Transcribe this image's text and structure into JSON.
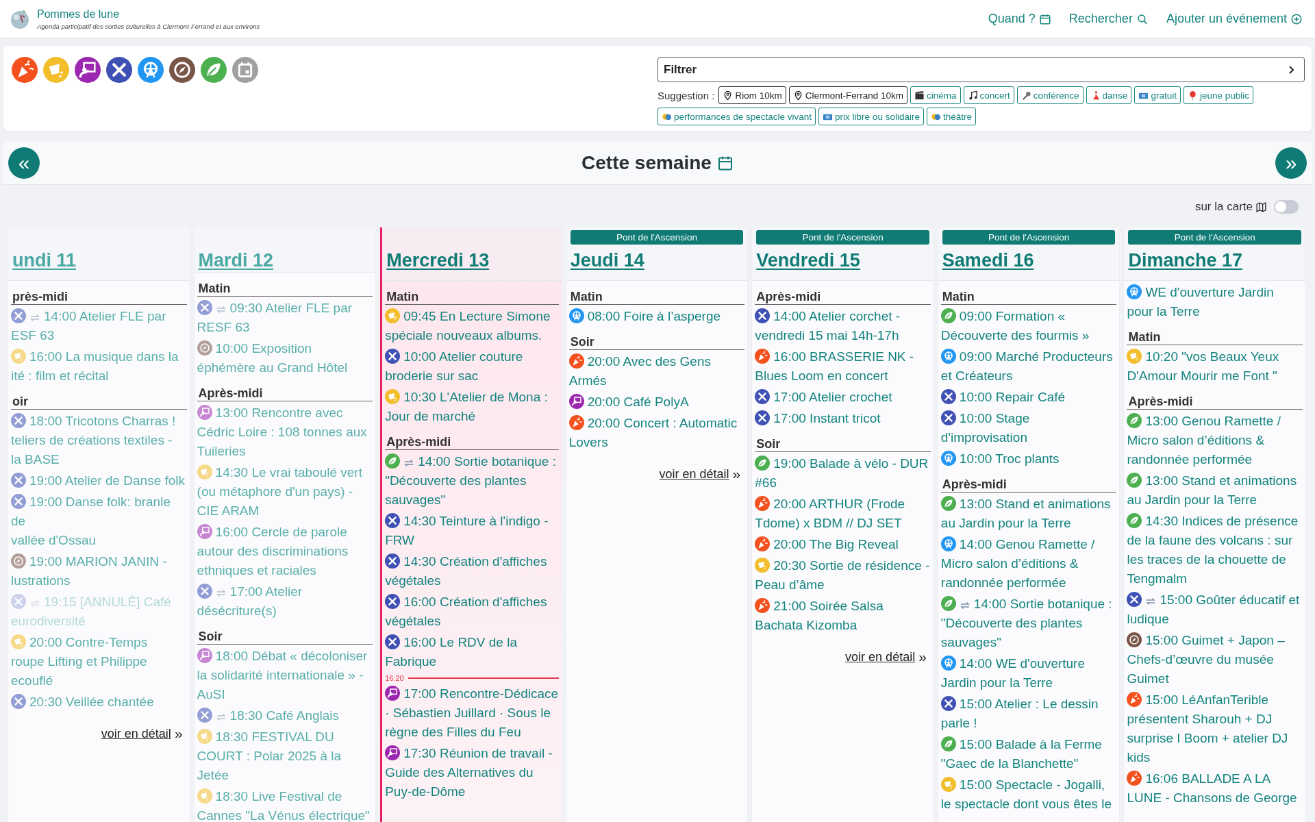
{
  "site": {
    "title": "Pommes de lune",
    "tagline": "Agenda participatif des sorties culturelles à Clermont-Ferrand et aux environs"
  },
  "nav": [
    {
      "kind": "calendar",
      "label": "Quand ?"
    },
    {
      "kind": "search",
      "label": "Rechercher"
    },
    {
      "kind": "add",
      "label": "Ajouter un événement"
    }
  ],
  "categories": [
    {
      "kind": "fete"
    },
    {
      "kind": "spectacle"
    },
    {
      "kind": "rencontre"
    },
    {
      "kind": "atelier"
    },
    {
      "kind": "collectif"
    },
    {
      "kind": "visite"
    },
    {
      "kind": "nature"
    },
    {
      "kind": "agenda"
    }
  ],
  "filter": {
    "label": "Filtrer"
  },
  "suggestions": {
    "label": "Suggestion :",
    "chips": [
      {
        "kind": "place",
        "label": "Riom 10km"
      },
      {
        "kind": "place",
        "label": "Clermont-Ferrand 10km"
      },
      {
        "kind": "cinema",
        "label": "cinéma"
      },
      {
        "kind": "concert",
        "label": "concert"
      },
      {
        "kind": "conference",
        "label": "conférence"
      },
      {
        "kind": "danse",
        "label": "danse"
      },
      {
        "kind": "gratuit",
        "label": "gratuit"
      },
      {
        "kind": "jeune-public",
        "label": "jeune public"
      },
      {
        "kind": "spectacle",
        "label": "performances de spectacle vivant"
      },
      {
        "kind": "gratuit",
        "label": "prix libre ou solidaire"
      },
      {
        "kind": "spectacle",
        "label": "théâtre"
      }
    ]
  },
  "week": {
    "title": "Cette semaine",
    "prev": "«",
    "next": "»"
  },
  "map_toggle": {
    "label": "sur la carte",
    "on": false
  },
  "days": [
    {
      "title": "undi 11",
      "past": true,
      "today": false,
      "sections": [
        {
          "heading": "près-midi",
          "events": [
            {
              "kind": "atelier",
              "recurring": true,
              "cancelled": false,
              "lines": [
                "14:00 Atelier FLE par",
                "ESF 63"
              ]
            },
            {
              "kind": "spectacle",
              "recurring": false,
              "cancelled": false,
              "lines": [
                "16:00 La musique dans la",
                "ité : film et récital"
              ]
            }
          ]
        },
        {
          "heading": "oir",
          "events": [
            {
              "kind": "atelier",
              "recurring": false,
              "cancelled": false,
              "lines": [
                "18:00 Tricotons Charras !",
                "teliers de créations textiles -",
                "la BASE"
              ]
            },
            {
              "kind": "atelier",
              "recurring": false,
              "cancelled": false,
              "lines": [
                "19:00 Atelier de Danse folk"
              ]
            },
            {
              "kind": "atelier",
              "recurring": false,
              "cancelled": false,
              "lines": [
                "19:00 Danse folk: branle de",
                "vallée d'Ossau"
              ]
            },
            {
              "kind": "visite",
              "recurring": false,
              "cancelled": false,
              "lines": [
                "19:00 MARION JANIN -",
                "lustrations"
              ]
            },
            {
              "kind": "atelier",
              "recurring": true,
              "cancelled": true,
              "lines": [
                "19:15 [ANNULÉ] Café",
                "eurodiversité"
              ]
            },
            {
              "kind": "spectacle",
              "recurring": false,
              "cancelled": false,
              "lines": [
                "20:00 Contre-Temps",
                "roupe Lifting et Philippe",
                "ecouflé"
              ]
            },
            {
              "kind": "atelier",
              "recurring": false,
              "cancelled": false,
              "lines": [
                "20:30 Veillée chantée"
              ]
            }
          ]
        }
      ],
      "more": {
        "label": "voir en détail",
        "arrow": "»"
      }
    },
    {
      "title": "Mardi 12",
      "past": true,
      "today": false,
      "sections": [
        {
          "heading": "Matin",
          "events": [
            {
              "kind": "atelier",
              "recurring": true,
              "cancelled": false,
              "text": "09:30 Atelier FLE par RESF 63"
            },
            {
              "kind": "visite",
              "recurring": false,
              "cancelled": false,
              "text": "10:00 Exposition éphémère au Grand Hôtel"
            }
          ]
        },
        {
          "heading": "Après-midi",
          "events": [
            {
              "kind": "rencontre",
              "recurring": false,
              "cancelled": false,
              "text": "13:00 Rencontre avec Cédric Loire : 108 tonnes aux Tuileries"
            },
            {
              "kind": "spectacle",
              "recurring": false,
              "cancelled": false,
              "text": "14:30 Le vrai taboulé vert (ou métaphore d'un pays) - CIE ARAM"
            },
            {
              "kind": "rencontre",
              "recurring": false,
              "cancelled": false,
              "text": "16:00 Cercle de parole autour des discriminations ethniques et raciales"
            },
            {
              "kind": "atelier",
              "recurring": true,
              "cancelled": false,
              "text": "17:00 Atelier désécriture(s)"
            }
          ]
        },
        {
          "heading": "Soir",
          "events": [
            {
              "kind": "rencontre",
              "recurring": false,
              "cancelled": false,
              "text": "18:00 Débat « décoloniser la solidarité internationale » - AuSI"
            },
            {
              "kind": "atelier",
              "recurring": true,
              "cancelled": false,
              "text": "18:30 Café Anglais"
            },
            {
              "kind": "spectacle",
              "recurring": false,
              "cancelled": false,
              "text": "18:30 FESTIVAL DU COURT : Polar 2025 à la Jetée"
            },
            {
              "kind": "spectacle",
              "recurring": false,
              "cancelled": false,
              "text": "18:30 Live Festival de Cannes \"La Vénus électrique\""
            }
          ]
        }
      ]
    },
    {
      "title": "Mercredi 13",
      "past": false,
      "today": true,
      "sections": [
        {
          "heading": "Matin",
          "events": [
            {
              "kind": "spectacle",
              "recurring": false,
              "cancelled": false,
              "text": "09:45 En Lecture Simone spéciale nouveaux albums."
            },
            {
              "kind": "atelier",
              "recurring": false,
              "cancelled": false,
              "text": "10:00 Atelier couture broderie sur sac"
            },
            {
              "kind": "spectacle",
              "recurring": false,
              "cancelled": false,
              "text": "10:30 L'Atelier de Mona : Jour de marché"
            }
          ]
        },
        {
          "heading": "Après-midi",
          "events": [
            {
              "kind": "nature",
              "recurring": true,
              "cancelled": false,
              "text": "14:00 Sortie botanique : \"Découverte des plantes sauvages\""
            },
            {
              "kind": "atelier",
              "recurring": false,
              "cancelled": false,
              "text": "14:30 Teinture à l'indigo - FRW"
            },
            {
              "kind": "atelier",
              "recurring": false,
              "cancelled": false,
              "text": "14:30 Création d'affiches végétales"
            },
            {
              "kind": "atelier",
              "recurring": false,
              "cancelled": false,
              "text": "16:00 Création d'affiches végétales"
            },
            {
              "kind": "atelier",
              "recurring": false,
              "cancelled": false,
              "text": "16:00 Le RDV de la Fabrique"
            },
            {
              "kind": "now-line",
              "text": "16:20"
            },
            {
              "kind": "rencontre",
              "recurring": false,
              "cancelled": false,
              "text": "17:00 Rencontre-Dédicace · Sébastien Juillard · Sous le règne des Filles du Feu"
            },
            {
              "kind": "rencontre",
              "recurring": false,
              "cancelled": false,
              "text": "17:30 Réunion de travail - Guide des Alternatives du Puy-de-Dôme"
            }
          ]
        }
      ]
    },
    {
      "title": "Jeudi 14",
      "past": false,
      "today": false,
      "banner": "Pont de l'Ascension",
      "sections": [
        {
          "heading": "Matin",
          "events": [
            {
              "kind": "collectif",
              "recurring": false,
              "cancelled": false,
              "text": "08:00 Foire à l’asperge"
            }
          ]
        },
        {
          "heading": "Soir",
          "events": [
            {
              "kind": "fete",
              "recurring": false,
              "cancelled": false,
              "text": "20:00 Avec des Gens Armés"
            },
            {
              "kind": "rencontre",
              "recurring": false,
              "cancelled": false,
              "text": "20:00 Café PolyA"
            },
            {
              "kind": "fete",
              "recurring": false,
              "cancelled": false,
              "text": "20:00 Concert : Automatic Lovers"
            }
          ]
        }
      ],
      "more": {
        "label": "voir en détail",
        "arrow": "»"
      }
    },
    {
      "title": "Vendredi 15",
      "past": false,
      "today": false,
      "banner": "Pont de l'Ascension",
      "sections": [
        {
          "heading": "Après-midi",
          "events": [
            {
              "kind": "atelier",
              "recurring": false,
              "cancelled": false,
              "text": "14:00 Atelier corchet - vendredi 15 mai 14h-17h"
            },
            {
              "kind": "fete",
              "recurring": false,
              "cancelled": false,
              "text": "16:00 BRASSERIE NK - Blues Loom en concert"
            },
            {
              "kind": "atelier",
              "recurring": false,
              "cancelled": false,
              "text": "17:00 Atelier crochet"
            },
            {
              "kind": "atelier",
              "recurring": false,
              "cancelled": false,
              "text": "17:00 Instant tricot"
            }
          ]
        },
        {
          "heading": "Soir",
          "events": [
            {
              "kind": "nature",
              "recurring": false,
              "cancelled": false,
              "text": "19:00 Balade à vélo - DUR #66"
            },
            {
              "kind": "fete",
              "recurring": false,
              "cancelled": false,
              "text": "20:00 ARTHUR (Frode Tdome) x BDM // DJ SET"
            },
            {
              "kind": "fete",
              "recurring": false,
              "cancelled": false,
              "text": "20:00 The Big Reveal"
            },
            {
              "kind": "spectacle",
              "recurring": false,
              "cancelled": false,
              "text": "20:30 Sortie de résidence - Peau d’âme"
            },
            {
              "kind": "fete",
              "recurring": false,
              "cancelled": false,
              "text": "21:00 Soirée Salsa Bachata Kizomba"
            }
          ]
        }
      ],
      "more": {
        "label": "voir en détail",
        "arrow": "»"
      }
    },
    {
      "title": "Samedi 16",
      "past": false,
      "today": false,
      "banner": "Pont de l'Ascension",
      "sections": [
        {
          "heading": "Matin",
          "events": [
            {
              "kind": "nature",
              "recurring": false,
              "cancelled": false,
              "text": "09:00 Formation « Découverte des fourmis »"
            },
            {
              "kind": "collectif",
              "recurring": false,
              "cancelled": false,
              "text": "09:00 Marché Producteurs et Créateurs"
            },
            {
              "kind": "atelier",
              "recurring": false,
              "cancelled": false,
              "text": "10:00 Repair Café"
            },
            {
              "kind": "atelier",
              "recurring": false,
              "cancelled": false,
              "text": "10:00 Stage d'improvisation"
            },
            {
              "kind": "collectif",
              "recurring": false,
              "cancelled": false,
              "text": "10:00 Troc plants"
            }
          ]
        },
        {
          "heading": "Après-midi",
          "events": [
            {
              "kind": "nature",
              "recurring": false,
              "cancelled": false,
              "text": "13:00 Stand et animations au Jardin pour la Terre"
            },
            {
              "kind": "collectif",
              "recurring": false,
              "cancelled": false,
              "text": "14:00 Genou Ramette / Micro salon d’éditions & randonnée performée"
            },
            {
              "kind": "nature",
              "recurring": true,
              "cancelled": false,
              "text": "14:00 Sortie botanique : \"Découverte des plantes sauvages\""
            },
            {
              "kind": "collectif",
              "recurring": false,
              "cancelled": false,
              "text": "14:00 WE d'ouverture Jardin pour la Terre"
            },
            {
              "kind": "atelier",
              "recurring": false,
              "cancelled": false,
              "text": "15:00 Atelier : Le dessin parle !"
            },
            {
              "kind": "nature",
              "recurring": false,
              "cancelled": false,
              "text": "15:00 Balade à la Ferme \"Gaec de la Blanchette\""
            },
            {
              "kind": "spectacle",
              "recurring": false,
              "cancelled": false,
              "text": "15:00 Spectacle - Jogalli, le spectacle dont vous êtes le"
            }
          ]
        }
      ]
    },
    {
      "title": "Dimanche 17",
      "past": false,
      "today": false,
      "banner": "Pont de l'Ascension",
      "sections": [
        {
          "events": [
            {
              "kind": "collectif",
              "recurring": false,
              "cancelled": false,
              "text": "WE d'ouverture Jardin pour la Terre"
            }
          ]
        },
        {
          "heading": "Matin",
          "events": [
            {
              "kind": "spectacle",
              "recurring": false,
              "cancelled": false,
              "text": "10:20 \"vos Beaux Yeux D'Amour Mourir me Font \""
            }
          ]
        },
        {
          "heading": "Après-midi",
          "events": [
            {
              "kind": "nature",
              "recurring": false,
              "cancelled": false,
              "text": "13:00 Genou Ramette / Micro salon d’éditions & randonnée performée"
            },
            {
              "kind": "nature",
              "recurring": false,
              "cancelled": false,
              "text": "13:00 Stand et animations au Jardin pour la Terre"
            },
            {
              "kind": "nature",
              "recurring": false,
              "cancelled": false,
              "text": "14:30 Indices de présence de la faune des volcans : sur les traces de la chouette de Tengmalm"
            },
            {
              "kind": "atelier",
              "recurring": true,
              "cancelled": false,
              "text": "15:00 Goûter éducatif et ludique"
            },
            {
              "kind": "visite",
              "recurring": false,
              "cancelled": false,
              "text": "15:00 Guimet + Japon – Chefs-d’œuvre du musée Guimet"
            },
            {
              "kind": "fete",
              "recurring": false,
              "cancelled": false,
              "text": "15:00 LéAnfanTerible présentent Sharouh + DJ surprise I Boom + atelier DJ kids"
            },
            {
              "kind": "fete",
              "recurring": false,
              "cancelled": false,
              "text": "16:06 BALLADE A LA LUNE - Chansons de George"
            }
          ]
        }
      ]
    }
  ]
}
